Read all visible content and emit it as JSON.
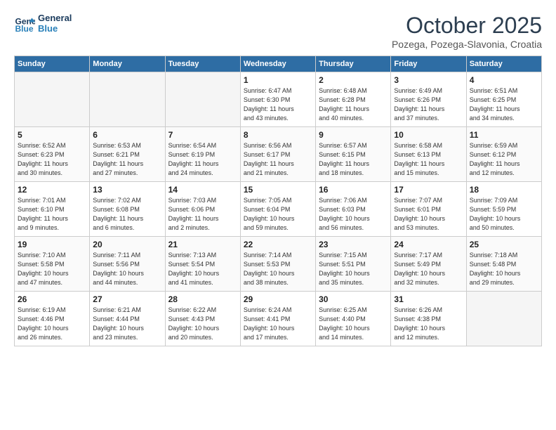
{
  "header": {
    "logo_line1": "General",
    "logo_line2": "Blue",
    "month": "October 2025",
    "location": "Pozega, Pozega-Slavonia, Croatia"
  },
  "weekdays": [
    "Sunday",
    "Monday",
    "Tuesday",
    "Wednesday",
    "Thursday",
    "Friday",
    "Saturday"
  ],
  "weeks": [
    [
      {
        "day": "",
        "info": ""
      },
      {
        "day": "",
        "info": ""
      },
      {
        "day": "",
        "info": ""
      },
      {
        "day": "1",
        "info": "Sunrise: 6:47 AM\nSunset: 6:30 PM\nDaylight: 11 hours\nand 43 minutes."
      },
      {
        "day": "2",
        "info": "Sunrise: 6:48 AM\nSunset: 6:28 PM\nDaylight: 11 hours\nand 40 minutes."
      },
      {
        "day": "3",
        "info": "Sunrise: 6:49 AM\nSunset: 6:26 PM\nDaylight: 11 hours\nand 37 minutes."
      },
      {
        "day": "4",
        "info": "Sunrise: 6:51 AM\nSunset: 6:25 PM\nDaylight: 11 hours\nand 34 minutes."
      }
    ],
    [
      {
        "day": "5",
        "info": "Sunrise: 6:52 AM\nSunset: 6:23 PM\nDaylight: 11 hours\nand 30 minutes."
      },
      {
        "day": "6",
        "info": "Sunrise: 6:53 AM\nSunset: 6:21 PM\nDaylight: 11 hours\nand 27 minutes."
      },
      {
        "day": "7",
        "info": "Sunrise: 6:54 AM\nSunset: 6:19 PM\nDaylight: 11 hours\nand 24 minutes."
      },
      {
        "day": "8",
        "info": "Sunrise: 6:56 AM\nSunset: 6:17 PM\nDaylight: 11 hours\nand 21 minutes."
      },
      {
        "day": "9",
        "info": "Sunrise: 6:57 AM\nSunset: 6:15 PM\nDaylight: 11 hours\nand 18 minutes."
      },
      {
        "day": "10",
        "info": "Sunrise: 6:58 AM\nSunset: 6:13 PM\nDaylight: 11 hours\nand 15 minutes."
      },
      {
        "day": "11",
        "info": "Sunrise: 6:59 AM\nSunset: 6:12 PM\nDaylight: 11 hours\nand 12 minutes."
      }
    ],
    [
      {
        "day": "12",
        "info": "Sunrise: 7:01 AM\nSunset: 6:10 PM\nDaylight: 11 hours\nand 9 minutes."
      },
      {
        "day": "13",
        "info": "Sunrise: 7:02 AM\nSunset: 6:08 PM\nDaylight: 11 hours\nand 6 minutes."
      },
      {
        "day": "14",
        "info": "Sunrise: 7:03 AM\nSunset: 6:06 PM\nDaylight: 11 hours\nand 2 minutes."
      },
      {
        "day": "15",
        "info": "Sunrise: 7:05 AM\nSunset: 6:04 PM\nDaylight: 10 hours\nand 59 minutes."
      },
      {
        "day": "16",
        "info": "Sunrise: 7:06 AM\nSunset: 6:03 PM\nDaylight: 10 hours\nand 56 minutes."
      },
      {
        "day": "17",
        "info": "Sunrise: 7:07 AM\nSunset: 6:01 PM\nDaylight: 10 hours\nand 53 minutes."
      },
      {
        "day": "18",
        "info": "Sunrise: 7:09 AM\nSunset: 5:59 PM\nDaylight: 10 hours\nand 50 minutes."
      }
    ],
    [
      {
        "day": "19",
        "info": "Sunrise: 7:10 AM\nSunset: 5:58 PM\nDaylight: 10 hours\nand 47 minutes."
      },
      {
        "day": "20",
        "info": "Sunrise: 7:11 AM\nSunset: 5:56 PM\nDaylight: 10 hours\nand 44 minutes."
      },
      {
        "day": "21",
        "info": "Sunrise: 7:13 AM\nSunset: 5:54 PM\nDaylight: 10 hours\nand 41 minutes."
      },
      {
        "day": "22",
        "info": "Sunrise: 7:14 AM\nSunset: 5:53 PM\nDaylight: 10 hours\nand 38 minutes."
      },
      {
        "day": "23",
        "info": "Sunrise: 7:15 AM\nSunset: 5:51 PM\nDaylight: 10 hours\nand 35 minutes."
      },
      {
        "day": "24",
        "info": "Sunrise: 7:17 AM\nSunset: 5:49 PM\nDaylight: 10 hours\nand 32 minutes."
      },
      {
        "day": "25",
        "info": "Sunrise: 7:18 AM\nSunset: 5:48 PM\nDaylight: 10 hours\nand 29 minutes."
      }
    ],
    [
      {
        "day": "26",
        "info": "Sunrise: 6:19 AM\nSunset: 4:46 PM\nDaylight: 10 hours\nand 26 minutes."
      },
      {
        "day": "27",
        "info": "Sunrise: 6:21 AM\nSunset: 4:44 PM\nDaylight: 10 hours\nand 23 minutes."
      },
      {
        "day": "28",
        "info": "Sunrise: 6:22 AM\nSunset: 4:43 PM\nDaylight: 10 hours\nand 20 minutes."
      },
      {
        "day": "29",
        "info": "Sunrise: 6:24 AM\nSunset: 4:41 PM\nDaylight: 10 hours\nand 17 minutes."
      },
      {
        "day": "30",
        "info": "Sunrise: 6:25 AM\nSunset: 4:40 PM\nDaylight: 10 hours\nand 14 minutes."
      },
      {
        "day": "31",
        "info": "Sunrise: 6:26 AM\nSunset: 4:38 PM\nDaylight: 10 hours\nand 12 minutes."
      },
      {
        "day": "",
        "info": ""
      }
    ]
  ]
}
